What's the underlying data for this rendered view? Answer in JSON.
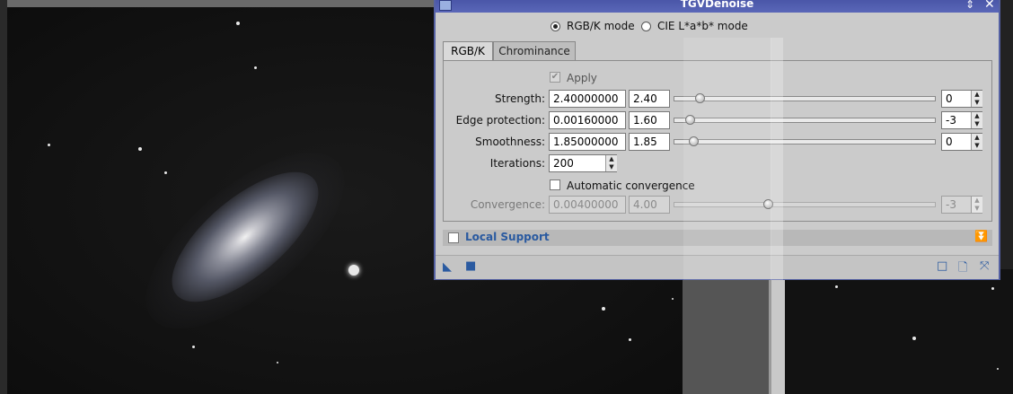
{
  "dialog": {
    "title": "TGVDenoise",
    "mode_options": [
      {
        "label": "RGB/K mode",
        "selected": true
      },
      {
        "label": "CIE L*a*b* mode",
        "selected": false
      }
    ],
    "tabs": [
      {
        "label": "RGB/K",
        "active": true
      },
      {
        "label": "Chrominance",
        "active": false
      }
    ],
    "apply_label": "Apply",
    "apply_checked": true,
    "rows": [
      {
        "label": "Strength:",
        "value": "2.40000000",
        "short": "2.40",
        "slider": 0.08,
        "spin": "0"
      },
      {
        "label": "Edge protection:",
        "value": "0.00160000",
        "short": "1.60",
        "slider": 0.04,
        "spin": "-3"
      },
      {
        "label": "Smoothness:",
        "value": "1.85000000",
        "short": "1.85",
        "slider": 0.055,
        "spin": "0"
      }
    ],
    "iterations_label": "Iterations:",
    "iterations_value": "200",
    "auto_convergence_label": "Automatic convergence",
    "auto_convergence_checked": false,
    "convergence": {
      "label": "Convergence:",
      "value": "0.00400000",
      "short": "4.00",
      "slider": 0.34,
      "spin": "-3"
    },
    "local_support_label": "Local Support",
    "local_support_checked": false
  },
  "colors": {
    "titlebar": "#4a56a8",
    "accent": "#2a5aa0"
  }
}
